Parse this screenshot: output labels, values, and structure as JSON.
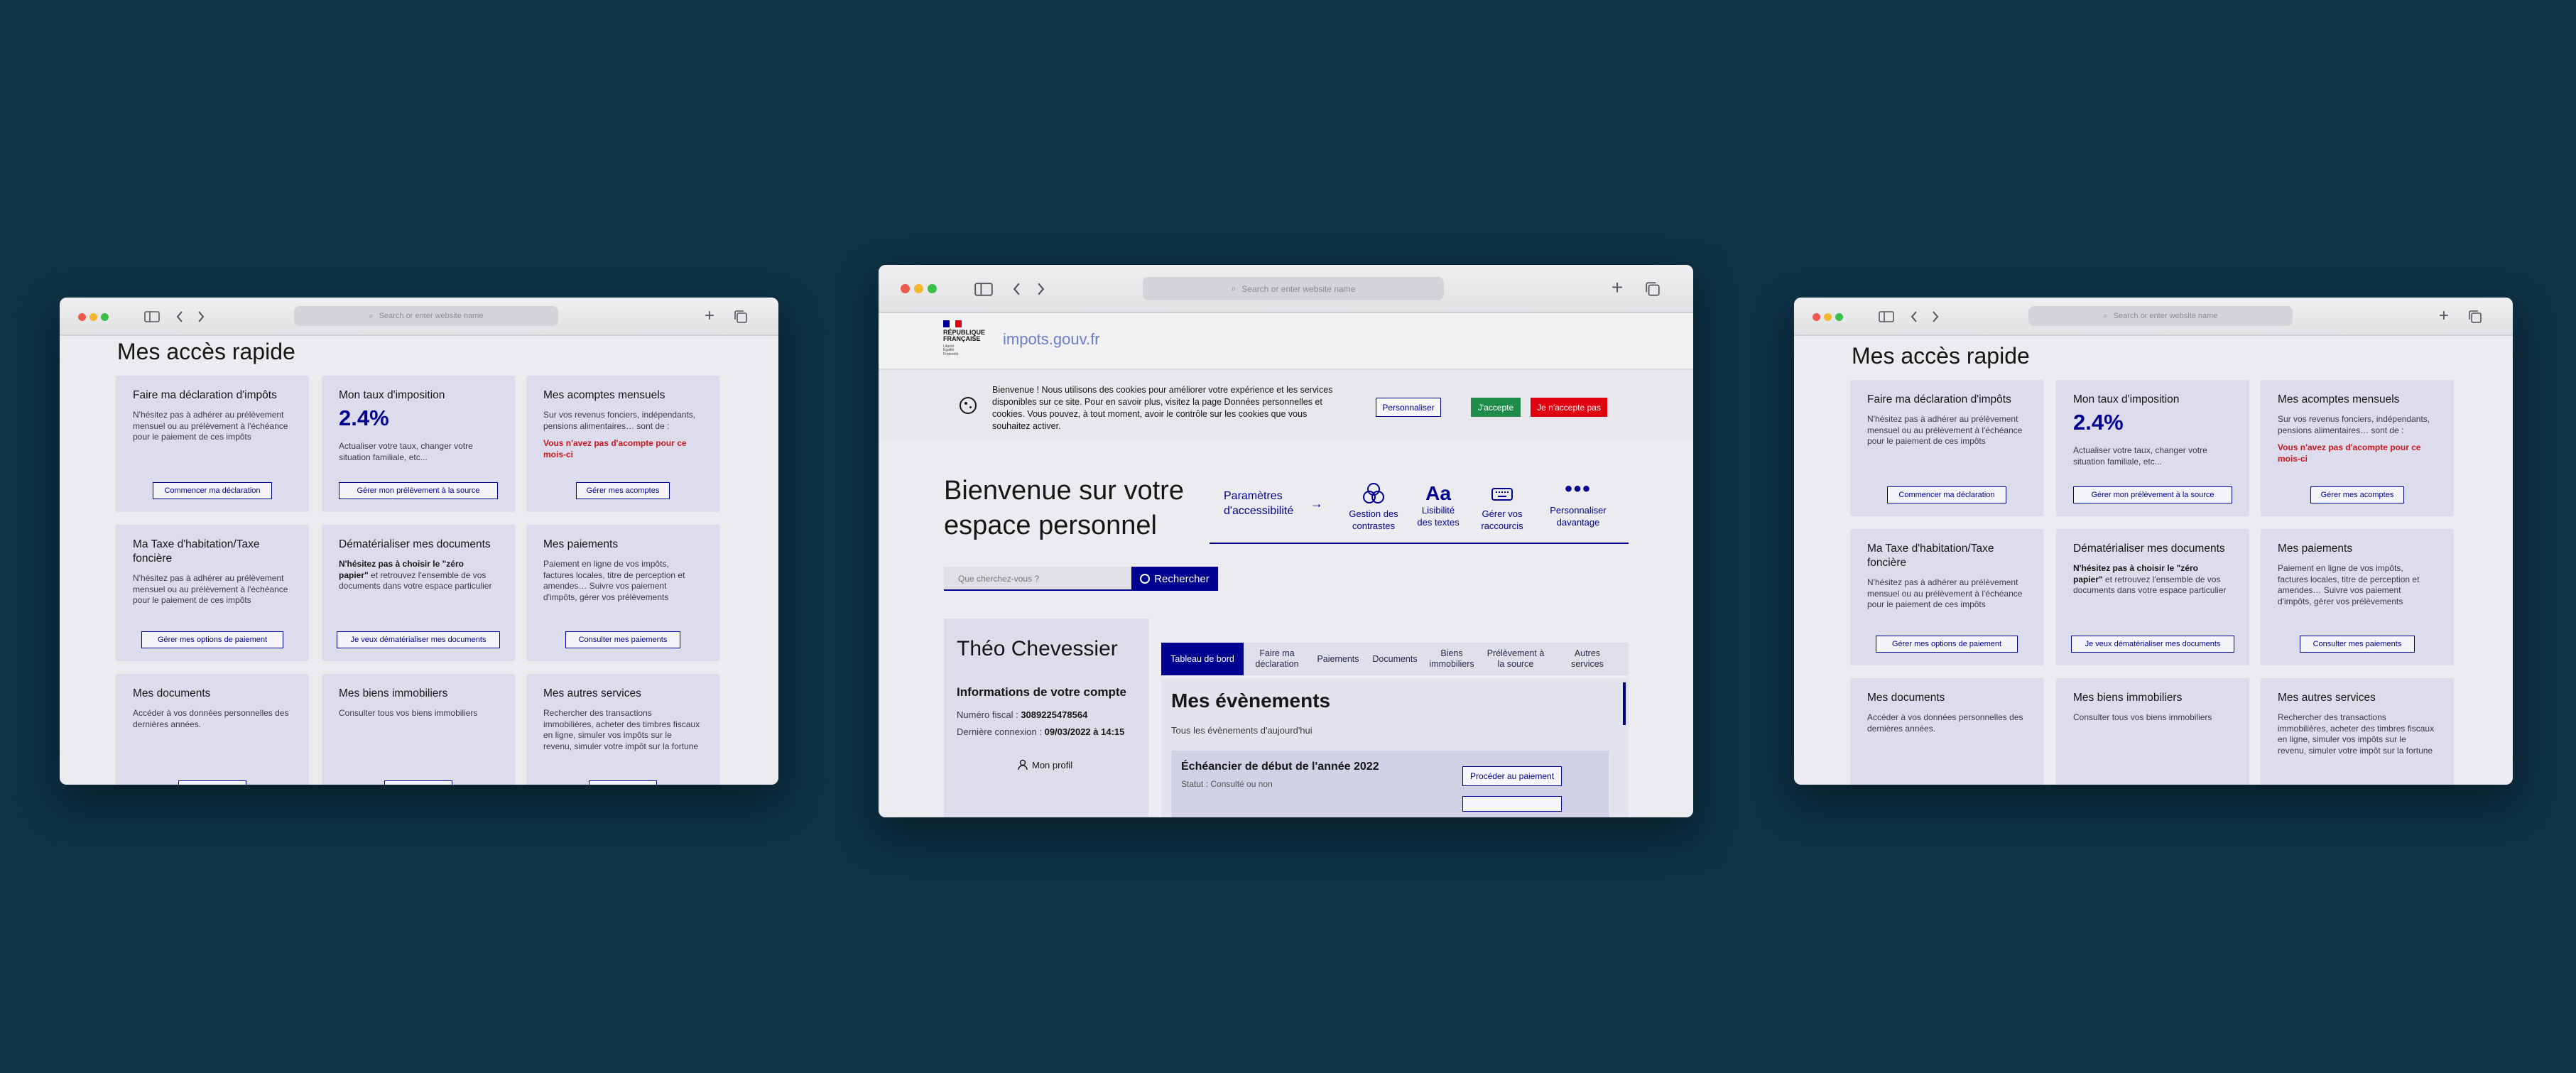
{
  "colors": {
    "background": "#0e3246",
    "accent": "#000091",
    "accept": "#1f8d49",
    "refuse": "#e1000f",
    "card": "#dcdcec"
  },
  "browser": {
    "address_placeholder": "Search or enter website name",
    "icons": [
      "sidebar-icon",
      "back-icon",
      "forward-icon",
      "new-tab-icon",
      "tabs-overview-icon"
    ]
  },
  "left": {
    "section_title": "Mes accès rapide",
    "cards": [
      {
        "title": "Faire ma déclaration d'impôts",
        "desc": "N'hésitez pas à adhérer au prélèvement mensuel ou au prélèvement à l'échéance pour le paiement de ces impôts",
        "button": "Commencer ma déclaration"
      },
      {
        "title": "Mon taux d'imposition",
        "rate": "2.4%",
        "desc": "Actualiser votre taux, changer votre situation familiale, etc...",
        "button": "Gérer mon prélèvement à la source"
      },
      {
        "title": "Mes acomptes mensuels",
        "desc": "Sur vos revenus fonciers, indépendants, pensions alimentaires… sont de :",
        "warning": "Vous n'avez pas d'acompte pour ce mois-ci",
        "button": "Gérer mes acomptes"
      },
      {
        "title": "Ma Taxe d'habitation/Taxe foncière",
        "desc": "N'hésitez pas à adhérer au prélèvement mensuel ou au prélèvement à l'échéance pour le paiement de ces impôts",
        "button": "Gérer mes options de paiement"
      },
      {
        "title": "Dématérialiser mes documents",
        "desc_bold": "N'hésitez pas à choisir le \"zéro papier\"",
        "desc": "et retrouvez l'ensemble de vos documents dans votre espace particulier",
        "button": "Je veux dématérialiser mes documents"
      },
      {
        "title": "Mes paiements",
        "desc": "Paiement en ligne de vos impôts, factures locales, titre de perception et amendes… Suivre vos paiement d'impôts, gérer vos prélèvements",
        "button": "Consulter mes paiements"
      },
      {
        "title": "Mes documents",
        "desc": "Accéder à vos données personnelles des dernières années.",
        "button": ""
      },
      {
        "title": "Mes biens immobiliers",
        "desc": "Consulter tous vos biens immobiliers",
        "button": ""
      },
      {
        "title": "Mes autres services",
        "desc": "Rechercher des transactions immobilières, acheter des timbres fiscaux en ligne, simuler vos impôts sur le revenu, simuler votre impôt sur la fortune",
        "button": ""
      }
    ]
  },
  "center": {
    "logo": {
      "republique": "RÉPUBLIQUE FRANÇAISE",
      "motto": "Liberté Égalité Fraternité",
      "site": "impots.gouv.fr"
    },
    "cookie": {
      "text": "Bienvenue ! Nous utilisons des cookies pour améliorer votre expérience et les services disponibles sur ce site. Pour en savoir plus, visitez la page Données personnelles et cookies. Vous pouvez, à tout moment, avoir le contrôle sur les cookies que vous souhaitez activer.",
      "personnaliser": "Personnaliser",
      "accept": "J'accepte",
      "refuse": "Je n'accepte pas"
    },
    "welcome": "Bienvenue sur votre espace personnel",
    "accessibility": {
      "title": "Paramètres d'accessibilité",
      "items": [
        {
          "label": "Gestion des contrastes",
          "icon": "contrast-icon"
        },
        {
          "label": "Lisibilité des textes",
          "icon": "text-size-icon",
          "glyph": "Aa"
        },
        {
          "label": "Gérer vos raccourcis",
          "icon": "keyboard-icon"
        },
        {
          "label": "Personnaliser davantage",
          "icon": "more-icon"
        }
      ]
    },
    "search": {
      "placeholder": "Que cherchez-vous ?",
      "button": "Rechercher"
    },
    "profile": {
      "name": "Théo Chevessier",
      "info_title": "Informations de votre compte",
      "fiscal_label": "Numéro fiscal :",
      "fiscal_value": "3089225478564",
      "connexion_label": "Dernière connexion :",
      "connexion_value": "09/03/2022 à 14:15",
      "profile_link": "Mon profil"
    },
    "tabs": [
      "Tableau de bord",
      "Faire ma déclaration",
      "Paiements",
      "Documents",
      "Biens immobiliers",
      "Prélèvement à la source",
      "Autres services"
    ],
    "events": {
      "title": "Mes évènements",
      "subtitle": "Tous les évènements d'aujourd'hui",
      "item_title": "Échéancier de début de l'année 2022",
      "item_status": "Statut : Consulté ou non",
      "item_button": "Procéder au paiement"
    }
  }
}
